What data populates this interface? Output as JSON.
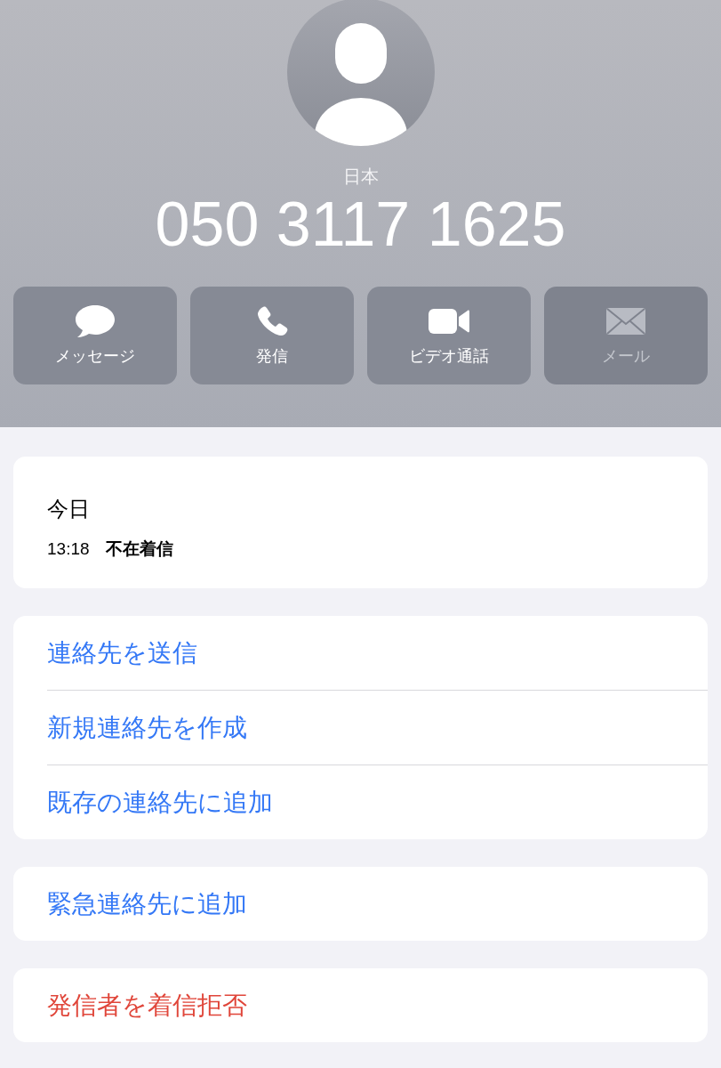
{
  "header": {
    "country": "日本",
    "number": "050 3117 1625"
  },
  "actions": [
    {
      "label": "メッセージ",
      "kind": "message",
      "disabled": false
    },
    {
      "label": "発信",
      "kind": "phone",
      "disabled": false
    },
    {
      "label": "ビデオ通話",
      "kind": "video",
      "disabled": false
    },
    {
      "label": "メール",
      "kind": "mail",
      "disabled": true
    }
  ],
  "history": {
    "day": "今日",
    "entries": [
      {
        "time": "13:18",
        "type": "不在着信"
      }
    ]
  },
  "groups": [
    [
      {
        "label": "連絡先を送信",
        "kind": "normal"
      },
      {
        "label": "新規連絡先を作成",
        "kind": "normal"
      },
      {
        "label": "既存の連絡先に追加",
        "kind": "normal"
      }
    ],
    [
      {
        "label": "緊急連絡先に追加",
        "kind": "normal"
      }
    ],
    [
      {
        "label": "発信者を着信拒否",
        "kind": "destructive"
      }
    ]
  ]
}
